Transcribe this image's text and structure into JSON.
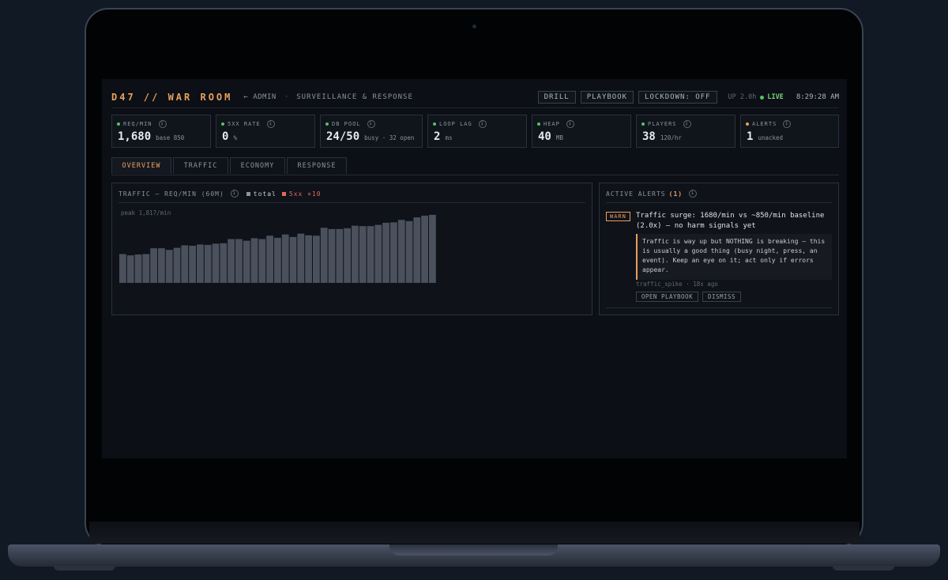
{
  "header": {
    "title": "D47 // WAR ROOM",
    "back_link": "← ADMIN",
    "separator": "·",
    "subtitle": "SURVEILLANCE & RESPONSE",
    "buttons": {
      "drill": "DRILL",
      "playbook": "PLAYBOOK",
      "lockdown": "LOCKDOWN: OFF"
    },
    "uptime": "UP 2.0h",
    "live": "LIVE",
    "clock": "8:29:28 AM"
  },
  "metrics": [
    {
      "label": "REQ/MIN",
      "value": "1,680",
      "unit": "base 850",
      "status": "green"
    },
    {
      "label": "5XX RATE",
      "value": "0",
      "unit": "%",
      "status": "green"
    },
    {
      "label": "DB POOL",
      "value": "24/50",
      "unit": "busy · 32 open",
      "status": "green"
    },
    {
      "label": "LOOP LAG",
      "value": "2",
      "unit": "ms",
      "status": "green"
    },
    {
      "label": "HEAP",
      "value": "40",
      "unit": "MB",
      "status": "green"
    },
    {
      "label": "PLAYERS",
      "value": "38",
      "unit": "120/hr",
      "status": "green"
    },
    {
      "label": "ALERTS",
      "value": "1",
      "unit": "unacked",
      "status": "orange"
    }
  ],
  "tabs": [
    "OVERVIEW",
    "TRAFFIC",
    "ECONOMY",
    "RESPONSE"
  ],
  "traffic_panel": {
    "title": "TRAFFIC — REQ/MIN (60M)",
    "legend_total": "total",
    "legend_5xx": "5xx ×10",
    "peak": "peak 1,817/min"
  },
  "alerts_panel": {
    "title": "ACTIVE ALERTS",
    "count": "(1)",
    "alert": {
      "severity": "WARN",
      "title": "Traffic surge: 1680/min vs ~850/min baseline (2.0x) — no harm signals yet",
      "body": "Traffic is way up but NOTHING is breaking — this is usually a good thing (busy night, press, an event). Keep an eye on it; act only if errors appear.",
      "meta": "traffic_spike · 18s ago",
      "btn_playbook": "OPEN PLAYBOOK",
      "btn_dismiss": "DISMISS"
    }
  },
  "colors": {
    "accent": "#e8a05c",
    "bar": "#4a505c",
    "error": "#e4685a",
    "live_green": "#58c25d"
  },
  "chart_data": {
    "type": "bar",
    "title": "TRAFFIC — REQ/MIN (60M)",
    "series": [
      {
        "name": "total",
        "values": [
          690,
          660,
          680,
          690,
          830,
          830,
          790,
          840,
          900,
          890,
          920,
          910,
          940,
          950,
          1050,
          1050,
          1010,
          1070,
          1050,
          1130,
          1080,
          1160,
          1100,
          1180,
          1140,
          1130,
          1320,
          1290,
          1290,
          1310,
          1370,
          1360,
          1360,
          1390,
          1440,
          1450,
          1510,
          1480,
          1570,
          1610,
          1630
        ]
      },
      {
        "name": "5xx ×10",
        "values": [
          0,
          0,
          0,
          0,
          0,
          0,
          0,
          0,
          0,
          0,
          0,
          0,
          0,
          0,
          0,
          0,
          0,
          0,
          0,
          0,
          0,
          0,
          0,
          0,
          0,
          0,
          0,
          0,
          0,
          0,
          0,
          0,
          0,
          0,
          0,
          0,
          0,
          0,
          0,
          0,
          0
        ]
      }
    ],
    "ylim": [
      0,
      1817
    ],
    "grid": false
  }
}
